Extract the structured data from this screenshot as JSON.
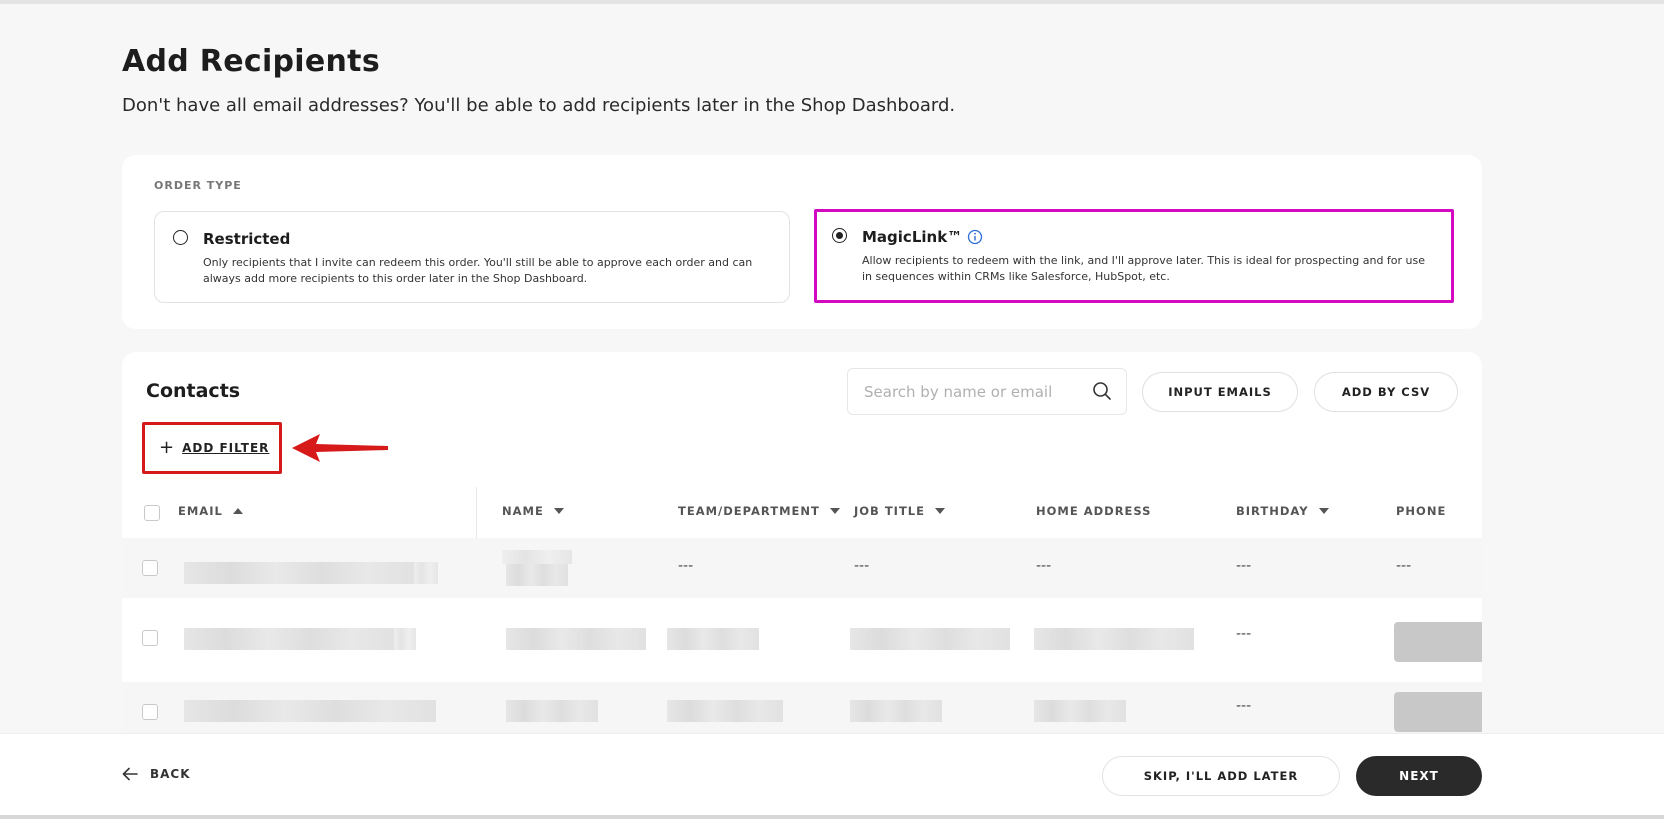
{
  "header": {
    "title": "Add Recipients",
    "subtitle": "Don't have all email addresses? You'll be able to add recipients later in the Shop Dashboard."
  },
  "order_type": {
    "label": "ORDER TYPE",
    "options": [
      {
        "title": "Restricted",
        "description": "Only recipients that I invite can redeem this order. You'll still be able to approve each order and can always add more recipients to this order later in the Shop Dashboard.",
        "selected": false
      },
      {
        "title": "MagicLink™",
        "description": "Allow recipients to redeem with the link, and I'll approve later. This is ideal for prospecting and for use in sequences within CRMs like Salesforce, HubSpot, etc.",
        "selected": true
      }
    ]
  },
  "contacts": {
    "title": "Contacts",
    "search_placeholder": "Search by name or email",
    "input_emails_label": "INPUT EMAILS",
    "add_csv_label": "ADD BY CSV",
    "add_filter_label": "ADD FILTER",
    "columns": [
      "EMAIL",
      "NAME",
      "TEAM/DEPARTMENT",
      "JOB TITLE",
      "HOME ADDRESS",
      "BIRTHDAY",
      "PHONE"
    ],
    "empty_value": "---"
  },
  "footer": {
    "back_label": "BACK",
    "skip_label": "SKIP, I'LL ADD LATER",
    "next_label": "NEXT"
  },
  "colors": {
    "highlight_magenta": "#d40ac3",
    "annotation_red": "#d61a1a",
    "primary_dark": "#2a2a2a",
    "info_blue": "#2d6fd6"
  }
}
